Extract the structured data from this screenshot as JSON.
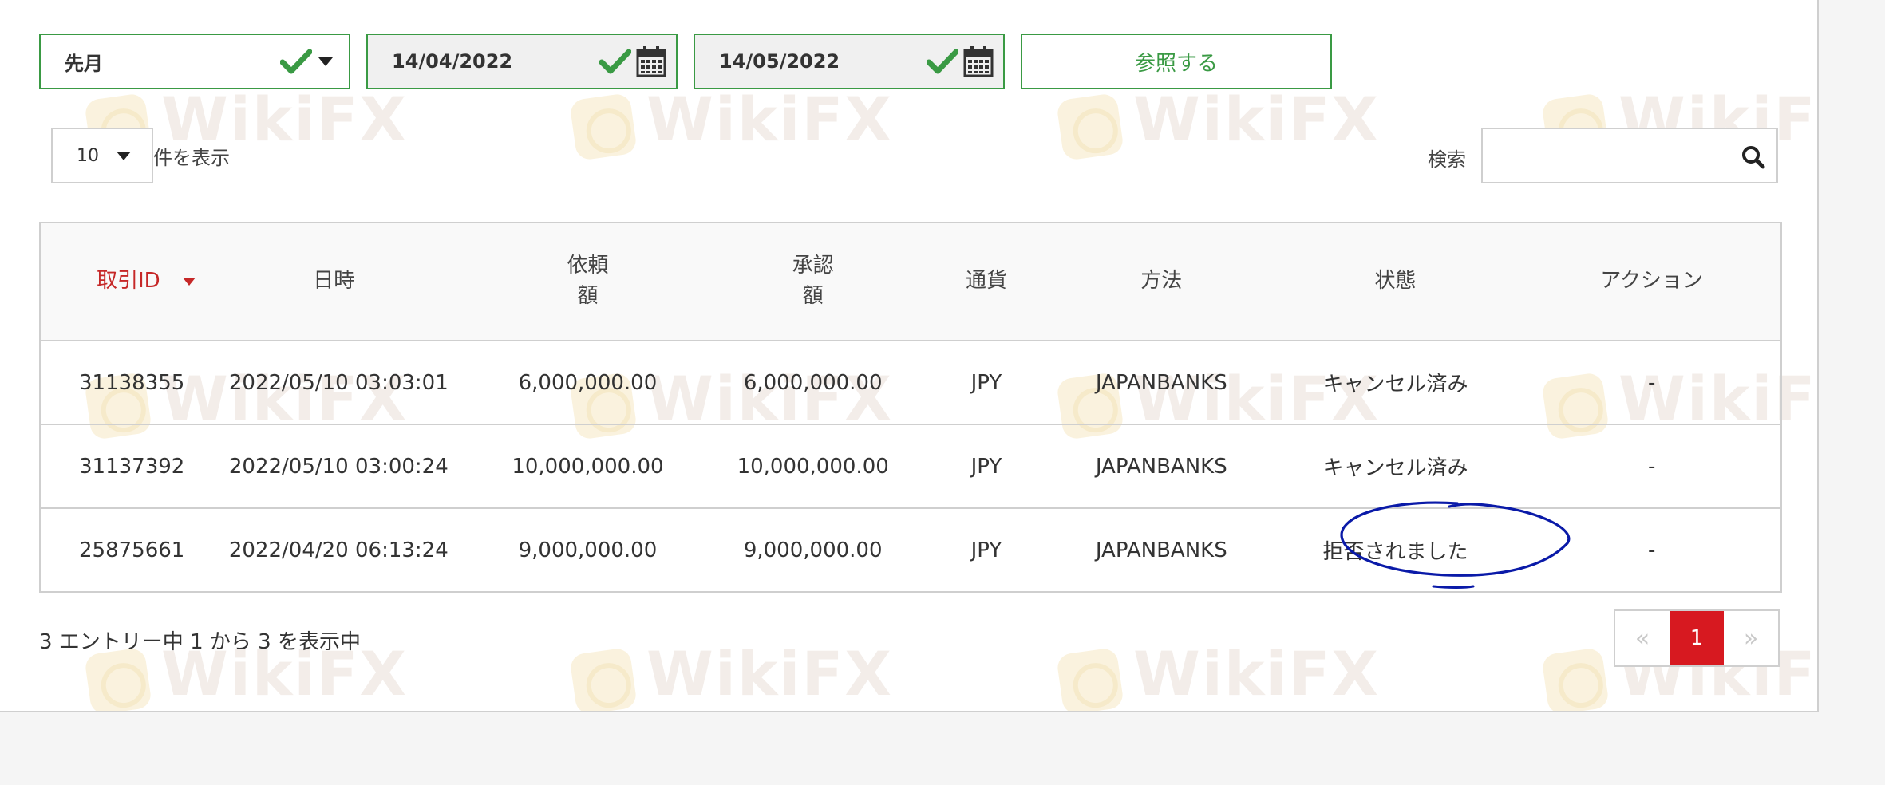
{
  "filters": {
    "period": "先月",
    "from_date": "14/04/2022",
    "to_date": "14/05/2022",
    "submit_label": "参照する"
  },
  "length": {
    "value": "10",
    "label": "件を表示"
  },
  "search": {
    "label": "検索",
    "value": ""
  },
  "table": {
    "headers": {
      "id": "取引ID",
      "datetime": "日時",
      "requested_1": "依頼",
      "requested_2": "額",
      "approved_1": "承認",
      "approved_2": "額",
      "currency": "通貨",
      "method": "方法",
      "status": "状態",
      "action": "アクション"
    },
    "rows": [
      {
        "id": "31138355",
        "datetime": "2022/05/10 03:03:01",
        "requested": "6,000,000.00",
        "approved": "6,000,000.00",
        "currency": "JPY",
        "method": "JAPANBANKS",
        "status": "キャンセル済み",
        "action": "-"
      },
      {
        "id": "31137392",
        "datetime": "2022/05/10 03:00:24",
        "requested": "10,000,000.00",
        "approved": "10,000,000.00",
        "currency": "JPY",
        "method": "JAPANBANKS",
        "status": "キャンセル済み",
        "action": "-"
      },
      {
        "id": "25875661",
        "datetime": "2022/04/20 06:13:24",
        "requested": "9,000,000.00",
        "approved": "9,000,000.00",
        "currency": "JPY",
        "method": "JAPANBANKS",
        "status": "拒否されました",
        "action": "-"
      }
    ]
  },
  "footer": {
    "info": "3 エントリー中 1 から 3 を表示中",
    "prev": "«",
    "page": "1",
    "next": "»"
  },
  "watermark": "WikiFX",
  "colors": {
    "accent_green": "#3a9a44",
    "accent_red": "#d71920",
    "annotation_blue": "#0a1aa8"
  }
}
